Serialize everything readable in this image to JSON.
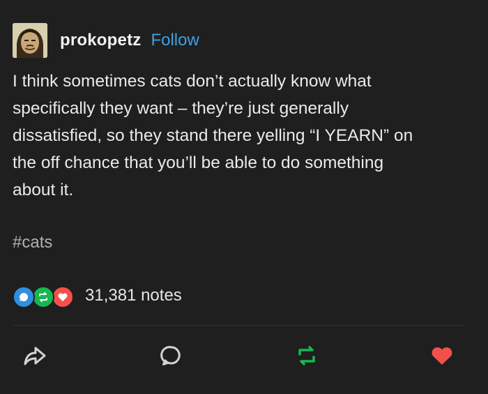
{
  "post": {
    "username": "prokopetz",
    "follow_label": "Follow",
    "body": "I think sometimes cats don’t actually know what\nspecifically they want – they’re just generally\ndissatisfied, so they stand there yelling “I YEARN” on\nthe off chance that you’ll be able to do something\nabout it.",
    "tags": [
      "#cats"
    ],
    "notes_count": "31,381 notes"
  },
  "icons": {
    "note_types": [
      "reply-icon",
      "reblog-icon",
      "like-icon"
    ],
    "actions": [
      "share-icon",
      "reply-icon",
      "reblog-icon",
      "like-icon"
    ]
  },
  "colors": {
    "background": "#1f1f1f",
    "follow": "#3ea0e0",
    "reply": "#2f8fe0",
    "reblog": "#15b84f",
    "like": "#f4504a",
    "tag": "#b0b0b0"
  }
}
